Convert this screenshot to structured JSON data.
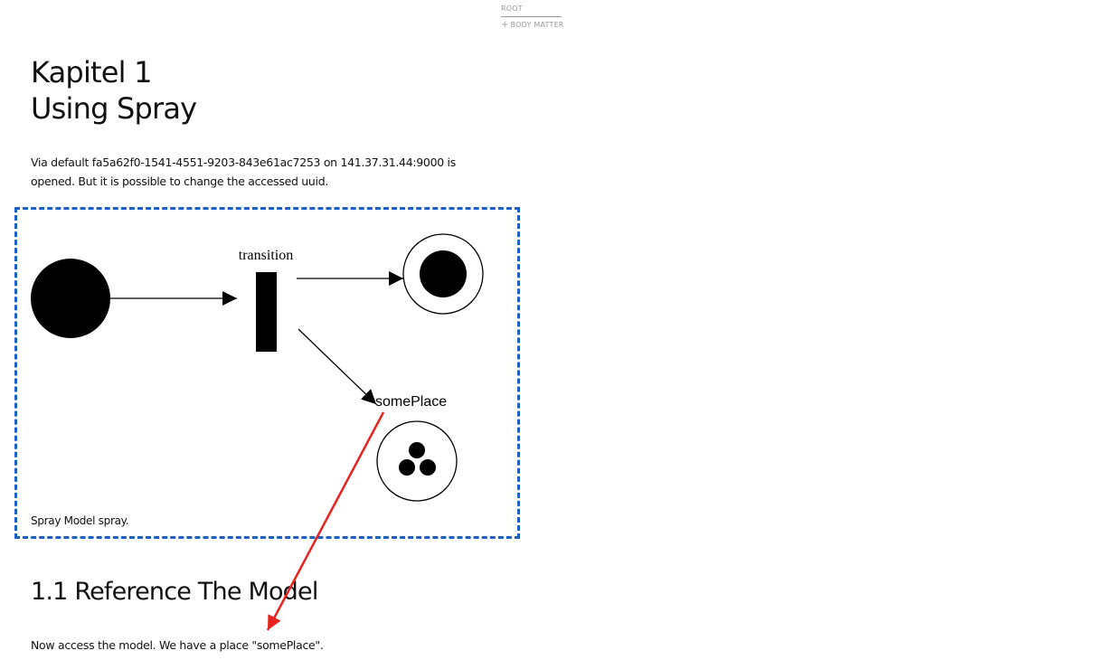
{
  "breadcrumb": {
    "root": "ROOT",
    "items": [
      {
        "label": "BODY MATTER",
        "icon": "plus-icon"
      }
    ]
  },
  "chapter": {
    "line1": "Kapitel 1",
    "line2": "Using Spray",
    "intro": "Via default fa5a62f0-1541-4551-9203-843e61ac7253 on 141.37.31.44:9000 is opened. But it is possible to change the accessed uuid."
  },
  "figure": {
    "caption": "Spray Model spray.",
    "transition_label": "transition",
    "place_label": "somePlace",
    "border_color": "#1b5fc7"
  },
  "section": {
    "title": "1.1 Reference The Model",
    "text": "Now access the model. We have a place \"somePlace\"."
  },
  "annotation": {
    "arrow_color": "#e8231f"
  }
}
